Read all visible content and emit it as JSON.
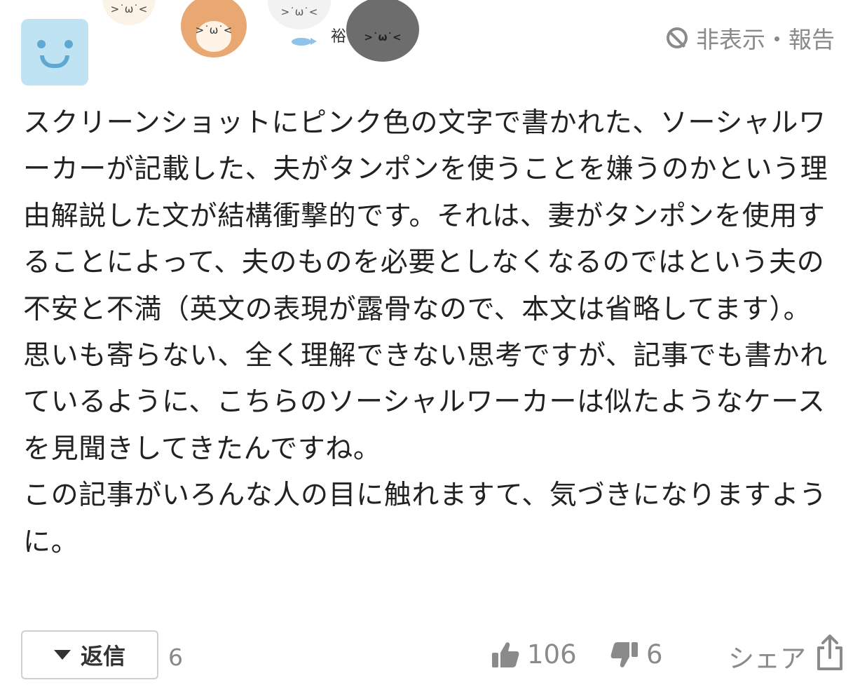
{
  "header": {
    "username_fragment": "裕",
    "hide_report_label": "非表示・報告",
    "cat_faces": [
      ">˙ω˙<",
      ">˙ω˙<",
      ">˙ω˙<",
      ">˙ω˙<"
    ]
  },
  "comment": {
    "body": "スクリーンショットにピンク色の文字で書かれた、ソーシャルワーカーが記載した、夫がタンポンを使うことを嫌うのかという理由解説した文が結構衝撃的です。それは、妻がタンポンを使用することによって、夫のものを必要としなくなるのではという夫の不安と不満（英文の表現が露骨なので、本文は省略してます）。\n思いも寄らない、全く理解できない思考ですが、記事でも書かれているように、こちらのソーシャルワーカーは似たようなケースを見聞きしてきたんですね。\nこの記事がいろんな人の目に触れますて、気づきになりますように。"
  },
  "footer": {
    "reply_label": "返信",
    "reply_count": "6",
    "likes": "106",
    "dislikes": "6",
    "share_label": "シェア"
  },
  "icons": [
    "smiley-avatar",
    "ban-icon",
    "thumbs-up-icon",
    "thumbs-down-icon",
    "share-icon",
    "caret-down-icon"
  ]
}
